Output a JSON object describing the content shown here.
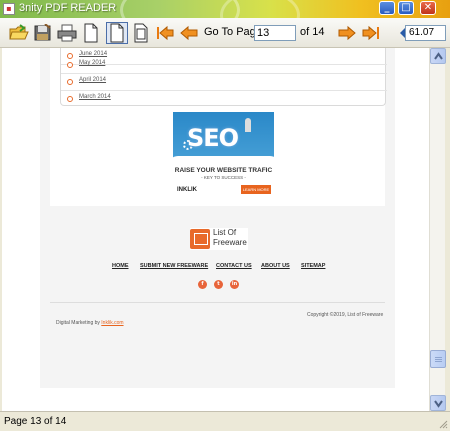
{
  "window": {
    "title": "3nity PDF READER"
  },
  "toolbar": {
    "goto_label": "Go To Page",
    "page_value": "13",
    "of_label": "of 14",
    "zoom_value": "61.07"
  },
  "document": {
    "archive": [
      "June 2014",
      "May 2014",
      "April 2014",
      "March 2014"
    ],
    "ad": {
      "headline": "SEO",
      "tagline": "RAISE YOUR WEBSITE TRAFIC",
      "subtag": "- KEY TO SUCCESS -",
      "brand": "INKLIK",
      "button": "LEARN MORE"
    },
    "logo_text": [
      "List Of",
      "Freeware"
    ],
    "footer_nav": [
      "HOME",
      "SUBMIT NEW FREEWARE",
      "CONTACT US",
      "ABOUT US",
      "SITEMAP"
    ],
    "social": [
      "f",
      "t",
      "in"
    ],
    "copyright": "Copyright ©2019, List of Freeware",
    "digital_prefix": "Digital Marketing by",
    "digital_link": "Inklik.com"
  },
  "status": {
    "text": "Page 13 of 14"
  }
}
